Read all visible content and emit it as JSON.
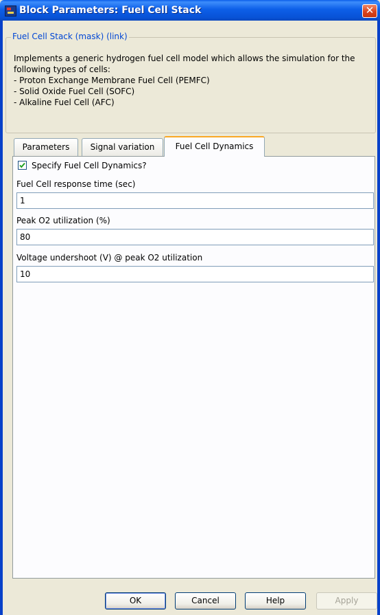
{
  "window": {
    "title": "Block Parameters: Fuel Cell Stack",
    "close_glyph": "✕"
  },
  "description": {
    "legend": "Fuel Cell Stack (mask) (link)",
    "lines": [
      "Implements a generic hydrogen fuel cell model which allows the simulation for the",
      "following types of cells:",
      "- Proton Exchange Membrane Fuel Cell (PEMFC)",
      "- Solid Oxide Fuel Cell (SOFC)",
      "- Alkaline Fuel Cell (AFC)"
    ]
  },
  "tabs": [
    {
      "label": "Parameters",
      "active": false
    },
    {
      "label": "Signal variation",
      "active": false
    },
    {
      "label": "Fuel Cell Dynamics",
      "active": true
    }
  ],
  "dynamics": {
    "checkbox_label": "Specify Fuel Cell Dynamics?",
    "checked": true,
    "fields": [
      {
        "label": "Fuel Cell response time (sec)",
        "value": "1"
      },
      {
        "label": "Peak O2 utilization (%)",
        "value": "80"
      },
      {
        "label": "Voltage undershoot (V) @ peak O2 utilization",
        "value": "10"
      }
    ]
  },
  "buttons": {
    "ok": "OK",
    "cancel": "Cancel",
    "help": "Help",
    "apply": "Apply"
  },
  "colors": {
    "titlebar": "#0a5ee9",
    "legend_text": "#0046d5",
    "active_tab_accent": "#f9a825",
    "check_mark": "#21a121"
  },
  "icons": [
    "simulink-block-icon",
    "close-icon",
    "checkmark-icon"
  ]
}
